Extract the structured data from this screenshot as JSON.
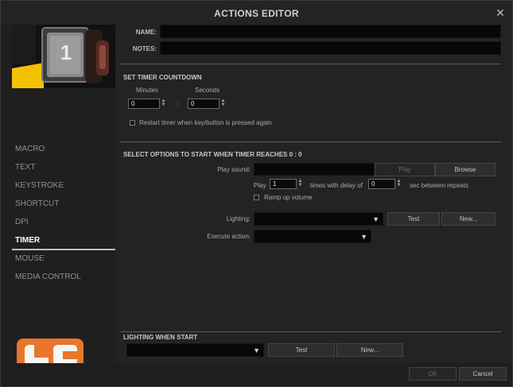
{
  "window": {
    "title": "ACTIONS EDITOR",
    "close_glyph": "✕"
  },
  "device": {
    "badge_number": "1"
  },
  "form": {
    "name_label": "NAME:",
    "name_value": "",
    "notes_label": "NOTES:",
    "notes_value": ""
  },
  "timer": {
    "section_title": "SET TIMER COUNTDOWN",
    "minutes_label": "Minutes",
    "seconds_label": "Seconds",
    "minutes_value": "0",
    "seconds_value": "0",
    "separator": ":",
    "restart_label": "Restart timer when key/button is pressed again"
  },
  "options": {
    "section_title": "SELECT OPTIONS TO START WHEN TIMER REACHES 0 : 0",
    "play_sound_label": "Play sound:",
    "play_button": "Play",
    "browse_button": "Browse",
    "play_label": "Play",
    "play_times_value": "1",
    "times_label": "times with delay of",
    "delay_value": "0",
    "sec_label": "sec between repeats",
    "ramp_label": "Ramp up volume",
    "lighting_label": "Lighting:",
    "lighting_test": "Test",
    "lighting_new": "New...",
    "execute_label": "Execute action:"
  },
  "lighting_start": {
    "section_title": "LIGHTING WHEN START",
    "test_button": "Test",
    "new_button": "New..."
  },
  "sidebar": {
    "items": [
      {
        "label": "MACRO"
      },
      {
        "label": "TEXT"
      },
      {
        "label": "KEYSTROKE"
      },
      {
        "label": "SHORTCUT"
      },
      {
        "label": "DPI"
      },
      {
        "label": "TIMER"
      },
      {
        "label": "MOUSE"
      },
      {
        "label": "MEDIA CONTROL"
      }
    ],
    "active_index": 5
  },
  "footer": {
    "ok_button": "OK",
    "cancel_button": "Cancel"
  },
  "colors": {
    "accent_orange": "#e8762b",
    "device_yellow": "#f2c200"
  }
}
